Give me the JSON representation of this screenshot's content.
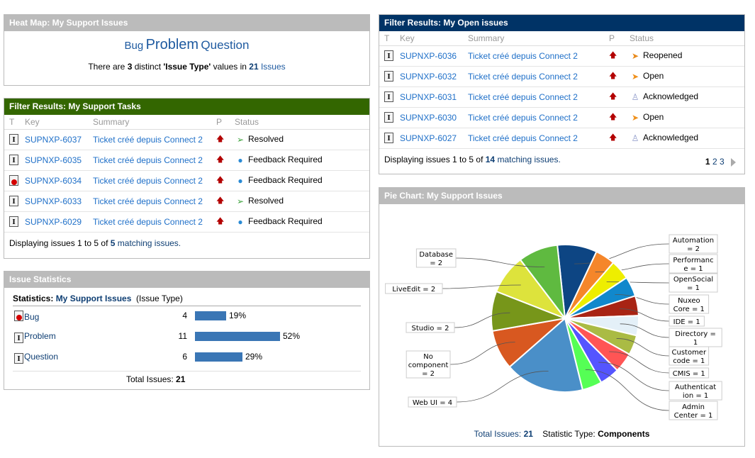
{
  "heatmap": {
    "title": "Heat Map: My Support Issues",
    "words": [
      "Bug",
      "Problem",
      "Question"
    ],
    "summary_prefix": "There are ",
    "distinct_count": "3",
    "summary_mid": " distinct ",
    "field_name": "'Issue Type'",
    "summary_mid2": " values in ",
    "issue_count": "21",
    "issues_link": "Issues"
  },
  "tasks": {
    "title": "Filter Results: My Support Tasks",
    "columns": [
      "T",
      "Key",
      "Summary",
      "P",
      "Status"
    ],
    "rows": [
      {
        "type": "Problem",
        "key": "SUPNXP-6037",
        "summary": "Ticket créé depuis Connect 2",
        "priority": "up-arrow",
        "status": "Resolved"
      },
      {
        "type": "Problem",
        "key": "SUPNXP-6035",
        "summary": "Ticket créé depuis Connect 2",
        "priority": "up-arrow",
        "status": "Feedback Required"
      },
      {
        "type": "Bug",
        "key": "SUPNXP-6034",
        "summary": "Ticket créé depuis Connect 2",
        "priority": "up-arrow",
        "status": "Feedback Required"
      },
      {
        "type": "Problem",
        "key": "SUPNXP-6033",
        "summary": "Ticket créé depuis Connect 2",
        "priority": "up-arrow",
        "status": "Resolved"
      },
      {
        "type": "Problem",
        "key": "SUPNXP-6029",
        "summary": "Ticket créé depuis Connect 2",
        "priority": "up-arrow",
        "status": "Feedback Required"
      }
    ],
    "footer_prefix": "Displaying issues 1 to 5 of ",
    "footer_total": "5",
    "footer_link": " matching issues."
  },
  "open": {
    "title": "Filter Results: My Open issues",
    "columns": [
      "T",
      "Key",
      "Summary",
      "P",
      "Status"
    ],
    "rows": [
      {
        "type": "Problem",
        "key": "SUPNXP-6036",
        "summary": "Ticket créé depuis Connect 2",
        "priority": "up-arrow",
        "status": "Reopened"
      },
      {
        "type": "Problem",
        "key": "SUPNXP-6032",
        "summary": "Ticket créé depuis Connect 2",
        "priority": "up-arrow",
        "status": "Open"
      },
      {
        "type": "Problem",
        "key": "SUPNXP-6031",
        "summary": "Ticket créé depuis Connect 2",
        "priority": "up-arrow",
        "status": "Acknowledged"
      },
      {
        "type": "Problem",
        "key": "SUPNXP-6030",
        "summary": "Ticket créé depuis Connect 2",
        "priority": "up-arrow",
        "status": "Open"
      },
      {
        "type": "Problem",
        "key": "SUPNXP-6027",
        "summary": "Ticket créé depuis Connect 2",
        "priority": "up-arrow",
        "status": "Acknowledged"
      }
    ],
    "footer_prefix": "Displaying issues 1 to 5 of ",
    "footer_total": "14",
    "footer_link": " matching issues.",
    "pages": [
      "1",
      "2",
      "3"
    ],
    "current_page": "1"
  },
  "stats": {
    "title": "Issue Statistics",
    "label": "Statistics: ",
    "filter_name": "My Support Issues",
    "field": "(Issue Type)",
    "rows": [
      {
        "name": "Bug",
        "icon": "bug",
        "count": "4",
        "percent": "19%",
        "fraction": 0.19
      },
      {
        "name": "Problem",
        "icon": "problem",
        "count": "11",
        "percent": "52%",
        "fraction": 0.52
      },
      {
        "name": "Question",
        "icon": "problem",
        "count": "6",
        "percent": "29%",
        "fraction": 0.29
      }
    ],
    "total_label": "Total Issues: ",
    "total": "21"
  },
  "pie": {
    "title": "Pie Chart: My Support Issues",
    "total_label": "Total Issues: ",
    "total": "21",
    "stat_label": "Statistic Type: ",
    "stat_value": "Components"
  },
  "chart_data": {
    "type": "pie",
    "title": "Pie Chart: My Support Issues",
    "categories": [
      "Automation",
      "Performance",
      "OpenSocial",
      "Nuxeo Core",
      "IDE",
      "Directory",
      "Customer code",
      "CMIS",
      "Authentication",
      "Admin Center",
      "Web UI",
      "No component",
      "Studio",
      "LiveEdit",
      "Database"
    ],
    "values": [
      2,
      1,
      1,
      1,
      1,
      1,
      1,
      1,
      1,
      1,
      4,
      2,
      2,
      2,
      2
    ],
    "label_lines": [
      [
        "Automation",
        "= 2"
      ],
      [
        "Performanc",
        "e = 1"
      ],
      [
        "OpenSocial",
        "= 1"
      ],
      [
        "Nuxeo",
        "Core = 1"
      ],
      [
        "IDE = 1"
      ],
      [
        "Directory =",
        "1"
      ],
      [
        "Customer",
        "code = 1"
      ],
      [
        "CMIS = 1"
      ],
      [
        "Authenticat",
        "ion = 1"
      ],
      [
        "Admin",
        "Center = 1"
      ],
      [
        "Web UI = 4"
      ],
      [
        "No",
        "component",
        "= 2"
      ],
      [
        "Studio = 2"
      ],
      [
        "LiveEdit = 2"
      ],
      [
        "Database",
        "= 2"
      ]
    ],
    "colors": [
      "#0d4583",
      "#f5862a",
      "#eeee00",
      "#1188cc",
      "#a82414",
      "#e4f0f8",
      "#aabb44",
      "#ff5555",
      "#5555ff",
      "#55ff55",
      "#4a8fc8",
      "#d85820",
      "#77961a",
      "#dde33c",
      "#5fba40"
    ],
    "total": 21
  }
}
